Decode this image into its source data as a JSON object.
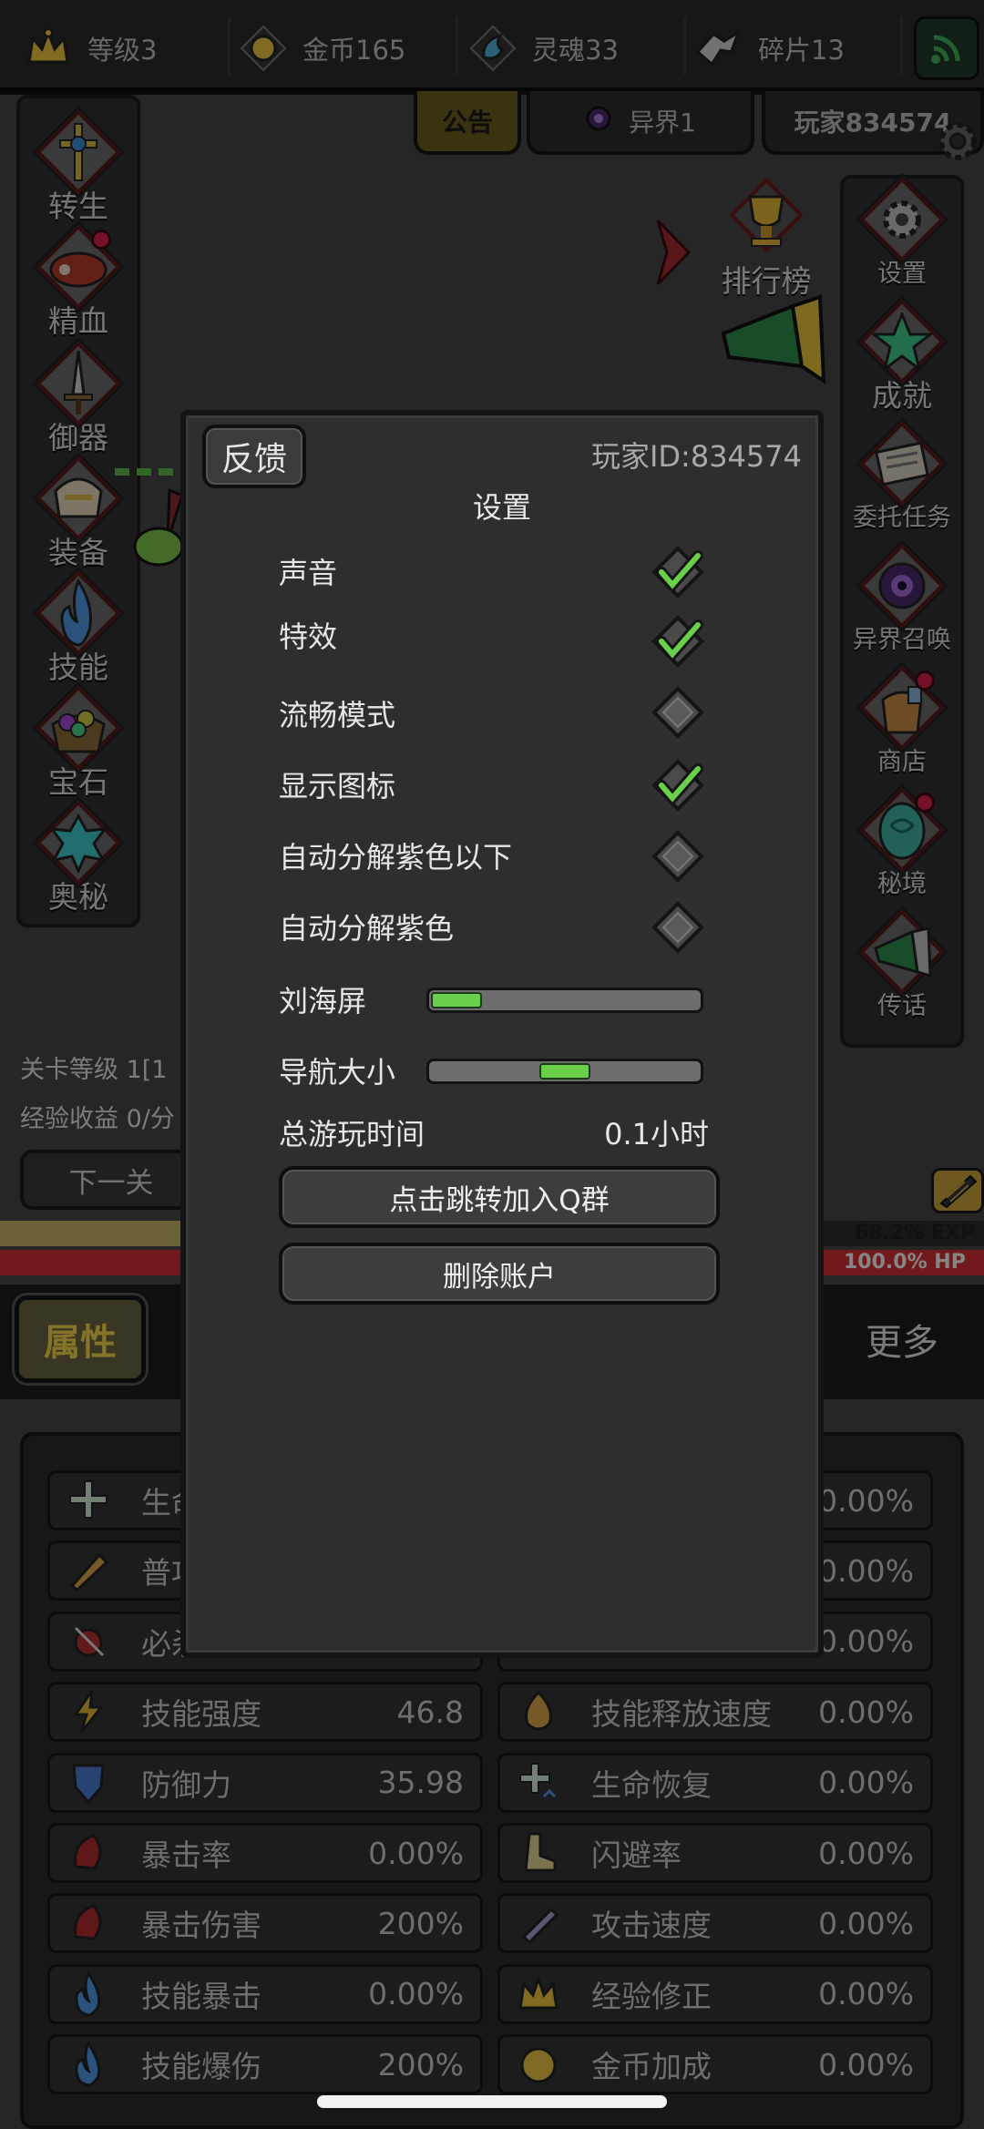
{
  "topbar": {
    "resources": [
      {
        "icon": "crown-icon",
        "label": "等级3"
      },
      {
        "icon": "gold-coin-icon",
        "label": "金币165"
      },
      {
        "icon": "soul-icon",
        "label": "灵魂33"
      },
      {
        "icon": "fragment-icon",
        "label": "碎片13"
      }
    ],
    "signal_icon": "signal-icon"
  },
  "tabs": {
    "notice": "公告",
    "other_world": "异界1",
    "player": "玩家834574"
  },
  "left_menu": [
    {
      "label": "转生",
      "icon": "rebirth-icon"
    },
    {
      "label": "精血",
      "icon": "blood-icon",
      "badge": true
    },
    {
      "label": "御器",
      "icon": "sword-icon"
    },
    {
      "label": "装备",
      "icon": "equipment-icon"
    },
    {
      "label": "技能",
      "icon": "skill-flame-icon"
    },
    {
      "label": "宝石",
      "icon": "gem-bag-icon"
    },
    {
      "label": "奥秘",
      "icon": "mystery-icon"
    }
  ],
  "leaderboard": "排行榜",
  "right_menu": [
    {
      "label": "设置",
      "icon": "gear-icon"
    },
    {
      "label": "成就",
      "icon": "star-icon"
    },
    {
      "label": "委托任务",
      "icon": "scroll-icon"
    },
    {
      "label": "异界召唤",
      "icon": "portal-icon"
    },
    {
      "label": "商店",
      "icon": "shop-bag-icon",
      "badge": true
    },
    {
      "label": "秘境",
      "icon": "secret-realm-icon",
      "badge": true
    },
    {
      "label": "传话",
      "icon": "horn-icon"
    }
  ],
  "stage": {
    "level": "关卡等级 1[1",
    "exp_gain": "经验收益 0/分",
    "next_button": "下一关"
  },
  "bars": {
    "exp_text": "68.2% EXP",
    "exp_fraction": 0.682,
    "hp_text": "100.0%  HP",
    "hp_fraction": 1.0
  },
  "bottom_tabs": {
    "attributes": "属性",
    "more": "更多"
  },
  "stats": {
    "left": [
      {
        "name": "生命",
        "value": "",
        "icon": "health-plus-icon"
      },
      {
        "name": "普攻",
        "value": "",
        "icon": "attack-icon"
      },
      {
        "name": "必杀",
        "value": "",
        "icon": "crit-kill-icon"
      },
      {
        "name": "技能强度",
        "value": "46.8",
        "icon": "lightning-icon"
      },
      {
        "name": "防御力",
        "value": "35.98",
        "icon": "shield-icon"
      },
      {
        "name": "暴击率",
        "value": "0.00%",
        "icon": "crit-rate-icon"
      },
      {
        "name": "暴击伤害",
        "value": "200%",
        "icon": "crit-damage-icon"
      },
      {
        "name": "技能暴击",
        "value": "0.00%",
        "icon": "skill-crit-icon"
      },
      {
        "name": "技能爆伤",
        "value": "200%",
        "icon": "skill-crit-damage-icon"
      }
    ],
    "right": [
      {
        "name": "",
        "value": "0.00%",
        "icon": "hidden-icon"
      },
      {
        "name": "",
        "value": "0.00%",
        "icon": "hidden-icon"
      },
      {
        "name": "",
        "value": "0.00%",
        "icon": "hidden-icon"
      },
      {
        "name": "技能释放速度",
        "value": "0.00%",
        "icon": "cast-speed-icon"
      },
      {
        "name": "生命恢复",
        "value": "0.00%",
        "icon": "regen-icon"
      },
      {
        "name": "闪避率",
        "value": "0.00%",
        "icon": "boot-icon"
      },
      {
        "name": "攻击速度",
        "value": "0.00%",
        "icon": "attack-speed-icon"
      },
      {
        "name": "经验修正",
        "value": "0.00%",
        "icon": "crown-icon"
      },
      {
        "name": "金币加成",
        "value": "0.00%",
        "icon": "gold-coin-icon"
      }
    ]
  },
  "settings_dialog": {
    "feedback": "反馈",
    "player_id": "玩家ID:834574",
    "title": "设置",
    "toggles": [
      {
        "label": "声音",
        "checked": true
      },
      {
        "label": "特效",
        "checked": true
      },
      {
        "label": "流畅模式",
        "checked": false
      },
      {
        "label": "显示图标",
        "checked": true
      },
      {
        "label": "自动分解紫色以下",
        "checked": false
      },
      {
        "label": "自动分解紫色",
        "checked": false
      }
    ],
    "sliders": [
      {
        "label": "刘海屏",
        "value": 0.0
      },
      {
        "label": "导航大小",
        "value": 0.5
      }
    ],
    "playtime_label": "总游玩时间",
    "playtime_value": "0.1小时",
    "join_group_button": "点击跳转加入Q群",
    "delete_account_button": "删除账户"
  },
  "colors": {
    "accent_gold": "#f0d24a",
    "check_green": "#6ad04a",
    "hp_red": "#cf2f34",
    "exp_tan": "#c6b56a"
  }
}
